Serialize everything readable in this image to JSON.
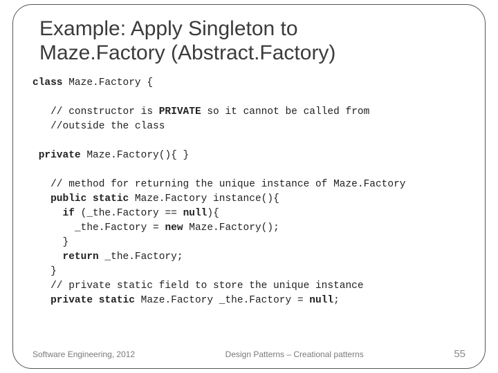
{
  "title_line1": "Example: Apply Singleton to",
  "title_line2": "Maze.Factory (Abstract.Factory)",
  "code": {
    "l1a": "class",
    "l1b": " Maze.Factory {",
    "l2": "   // constructor is ",
    "l2b": "PRIVATE",
    "l2c": " so it cannot be called from",
    "l3": "   //outside the class",
    "l4a": " private",
    "l4b": " Maze.Factory(){ }",
    "l5": "   // method for returning the unique instance of Maze.Factory",
    "l6a": "   public static",
    "l6b": " Maze.Factory instance(){",
    "l7a": "     if",
    "l7b": " (_the.Factory == ",
    "l7c": "null",
    "l7d": "){",
    "l8a": "       _the.Factory = ",
    "l8b": "new",
    "l8c": " Maze.Factory();",
    "l9": "     }",
    "l10a": "     return",
    "l10b": " _the.Factory;",
    "l11": "   }",
    "l12": "   // private static field to store the unique instance",
    "l13a": "   private static",
    "l13b": " Maze.Factory _the.Factory = ",
    "l13c": "null",
    "l13d": ";"
  },
  "footer_left": "Software Engineering, 2012",
  "footer_center": "Design Patterns – Creational patterns",
  "page_number": "55"
}
